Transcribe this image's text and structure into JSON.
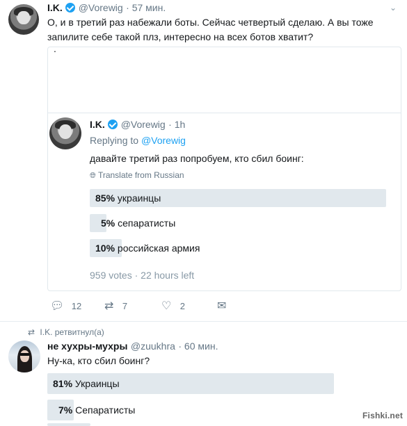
{
  "tweet": {
    "author_name": "I.K.",
    "author_handle": "@Vorewig",
    "time": "· 57 мин.",
    "text": "О, и в третий раз набежали боты. Сейчас четвертый сделаю. А вы тоже запилите себе такой плз, интересно на всех ботов хватит?",
    "quote_top_text": ".",
    "actions": {
      "reply_count": "12",
      "retweet_count": "7",
      "like_count": "2"
    }
  },
  "quoted": {
    "author_name": "I.K.",
    "author_handle": "@Vorewig",
    "time": "· 1h",
    "replying_prefix": "Replying to",
    "replying_handle": "@Vorewig",
    "text": "давайте третий раз попробуем, кто сбил боинг:",
    "translate_label": "Translate from Russian",
    "poll": [
      {
        "percent": "85%",
        "label": "украинцы",
        "fraction": 0.85
      },
      {
        "percent": "5%",
        "label": "сепаратисты",
        "fraction": 0.05
      },
      {
        "percent": "10%",
        "label": "российская армия",
        "fraction": 0.1
      }
    ],
    "poll_meta": "959 votes · 22 hours left"
  },
  "retweet": {
    "retweeted_by": "I.K. ретвитнул(а)",
    "author_name": "не хухры-мухры",
    "author_handle": "@zuukhra",
    "time": "· 60 мин.",
    "text": "Ну-ка, кто сбил боинг?",
    "poll": [
      {
        "percent": "81%",
        "label": "Украинцы",
        "fraction": 0.81
      },
      {
        "percent": "7%",
        "label": "Сепаратисты",
        "fraction": 0.07
      }
    ]
  },
  "watermark": "Fishki.net",
  "colors": {
    "accent": "#1da1f2",
    "poll_bar": "#e1e8ed",
    "muted": "#657786"
  }
}
